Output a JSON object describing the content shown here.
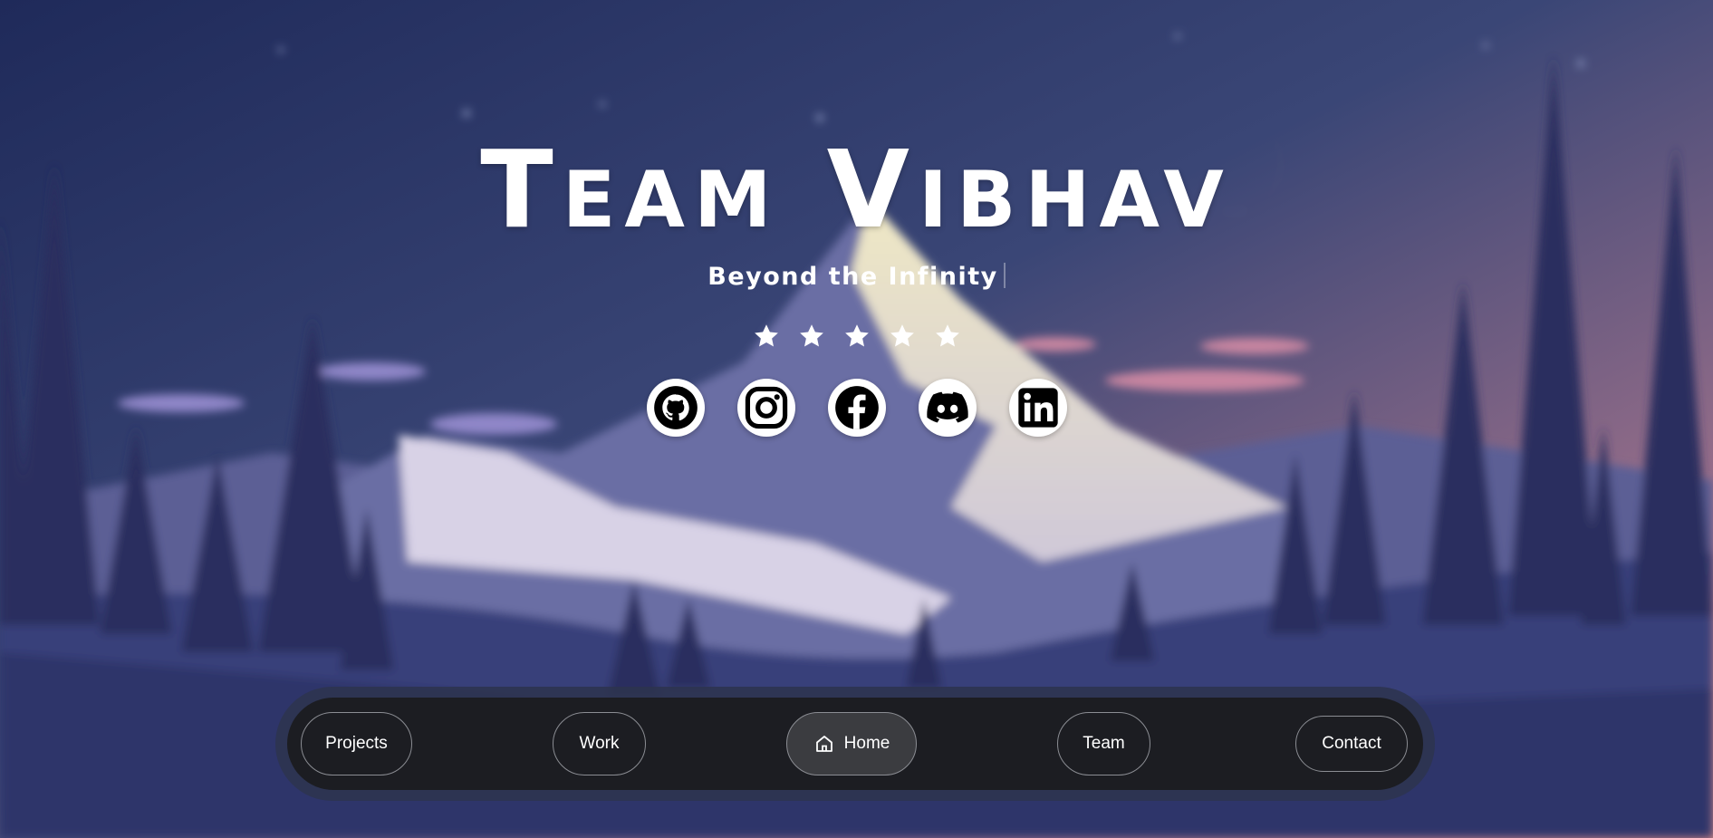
{
  "hero": {
    "title_initial_1": "T",
    "title_rest_1": "EAM",
    "title_initial_2": "V",
    "title_rest_2": "IBHAV",
    "tagline": "Beyond the Infinity"
  },
  "rating": {
    "stars": 5
  },
  "socials": [
    {
      "icon": "github-icon"
    },
    {
      "icon": "instagram-icon"
    },
    {
      "icon": "facebook-icon"
    },
    {
      "icon": "discord-icon"
    },
    {
      "icon": "linkedin-icon"
    }
  ],
  "nav": {
    "items": [
      {
        "label": "Projects"
      },
      {
        "label": "Work"
      },
      {
        "label": "Home",
        "icon": "home-icon",
        "active": true
      },
      {
        "label": "Team"
      },
      {
        "label": "Contact"
      }
    ]
  },
  "colors": {
    "sky_top": "#1f2a5a",
    "sky_bottom": "#c77f86",
    "nav_bg": "#1c1d22",
    "active_bg": "#3b3c40"
  }
}
